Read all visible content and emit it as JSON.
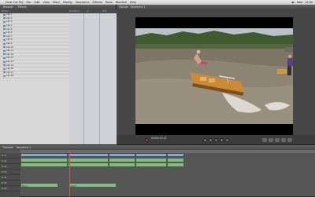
{
  "menubar": {
    "items": [
      "Final Cut Pro",
      "File",
      "Edit",
      "View",
      "Mark",
      "Modify",
      "Sequence",
      "Effects",
      "Tools",
      "Window",
      "Help"
    ],
    "right": [
      "◀)",
      "Wed",
      "12:00"
    ]
  },
  "browser": {
    "tabs": [
      "Browser",
      "Effects"
    ],
    "headers": [
      "Name",
      "Duration",
      "In",
      "Out"
    ],
    "items": [
      "Clip 1",
      "Clip 2",
      "Clip 3",
      "Clip 4",
      "Clip 5",
      "Clip 6",
      "Clip 7",
      "Clip 8",
      "Clip 9",
      "Clip 10",
      "Clip 11",
      "Clip 12",
      "Clip 13",
      "Clip 14",
      "Clip 15",
      "Clip 16",
      "Clip 17",
      "Clip 18"
    ]
  },
  "canvas": {
    "title": "Canvas",
    "sequence": "Sequence 1",
    "timecode": "00:00:41:23"
  },
  "timeline": {
    "title": "Timeline",
    "sequence": "Sequence 1",
    "tracks": [
      {
        "label": "V1"
      },
      {
        "label": "A1"
      },
      {
        "label": "A2"
      },
      {
        "label": "A3"
      },
      {
        "label": "A4"
      },
      {
        "label": "A5"
      },
      {
        "label": "A6"
      }
    ],
    "audio_labels": [
      "Music",
      "Music"
    ]
  },
  "colors": {
    "video_clip": "#8fa6c4",
    "audio_clip": "#8cb58c",
    "playhead": "#e04a4a"
  }
}
